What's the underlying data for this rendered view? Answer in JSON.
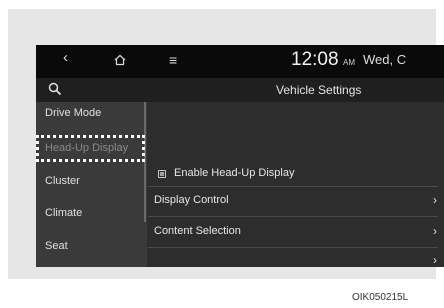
{
  "status_bar": {
    "back_icon": "back-chevron-icon",
    "home_icon": "home-icon",
    "menu_icon": "menu-icon",
    "time": "12:08",
    "ampm": "AM",
    "date": "Wed, C"
  },
  "header": {
    "search_icon": "search-icon",
    "title": "Vehicle Settings"
  },
  "sidebar": {
    "items": [
      {
        "label": "Drive Mode"
      },
      {
        "label": "Head-Up Display",
        "selected": true
      },
      {
        "label": "Cluster"
      },
      {
        "label": "Climate"
      },
      {
        "label": "Seat"
      }
    ]
  },
  "main": {
    "rows": [
      {
        "label": "Enable Head-Up Display",
        "type": "checkbox"
      },
      {
        "label": "Display Control",
        "type": "link"
      },
      {
        "label": "Content Selection",
        "type": "link"
      },
      {
        "label": "",
        "type": "link"
      }
    ]
  },
  "caption": "OIK050215L",
  "colors": {
    "topbar": "#0a0a0a",
    "panel": "#2d2d2d",
    "sidebar": "#3a3a3a",
    "highlight_border": "#ffffff"
  }
}
